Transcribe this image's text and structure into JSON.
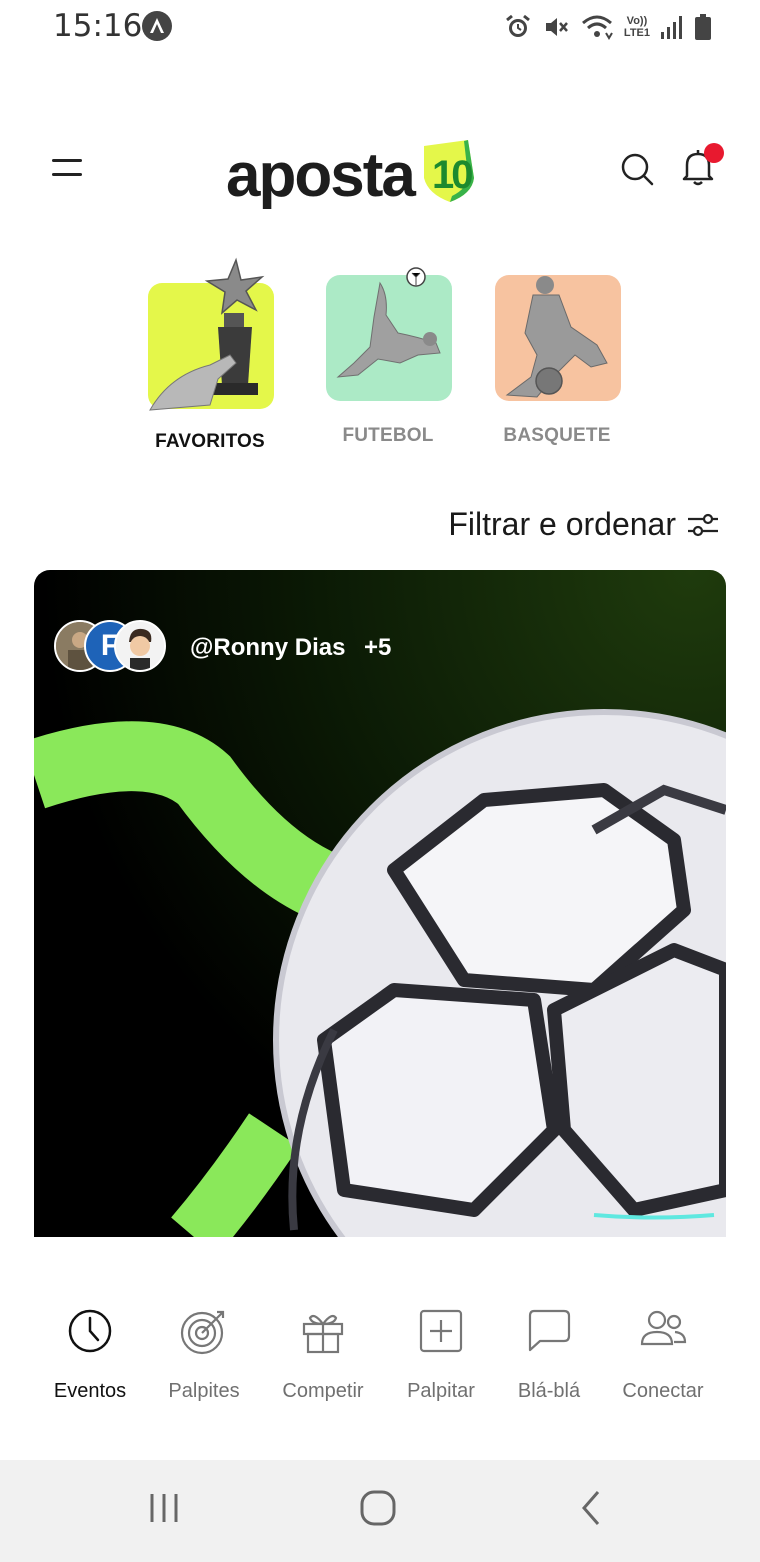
{
  "status_bar": {
    "time": "15:16",
    "network": "LTE1",
    "volte": "Vo))"
  },
  "header": {
    "logo_text": "aposta",
    "logo_badge_text": "10",
    "brand_color": "#e4f74a",
    "notification_dot_color": "#e8192f"
  },
  "categories": [
    {
      "label": "FAVORITOS",
      "selected": true,
      "tile_color": "#e4f74a",
      "icon": "trophy-hand-icon"
    },
    {
      "label": "FUTEBOL",
      "selected": false,
      "tile_color": "#9ee6bc",
      "icon": "soccer-player-icon"
    },
    {
      "label": "BASQUETE",
      "selected": false,
      "tile_color": "#f6b98f",
      "icon": "basketball-player-icon"
    }
  ],
  "filter": {
    "label": "Filtrar e ordenar",
    "icon": "sliders-icon"
  },
  "event_card": {
    "username": "@Ronny Dias",
    "extra_count": "+5",
    "avatar_initial": "F",
    "accent_color": "#8ae85a"
  },
  "bottom_nav": [
    {
      "label": "Eventos",
      "icon": "clock-icon",
      "active": true
    },
    {
      "label": "Palpites",
      "icon": "target-icon",
      "active": false
    },
    {
      "label": "Competir",
      "icon": "gift-icon",
      "active": false
    },
    {
      "label": "Palpitar",
      "icon": "plus-square-icon",
      "active": false
    },
    {
      "label": "Blá-blá",
      "icon": "chat-bubble-icon",
      "active": false
    },
    {
      "label": "Conectar",
      "icon": "users-icon",
      "active": false
    }
  ]
}
